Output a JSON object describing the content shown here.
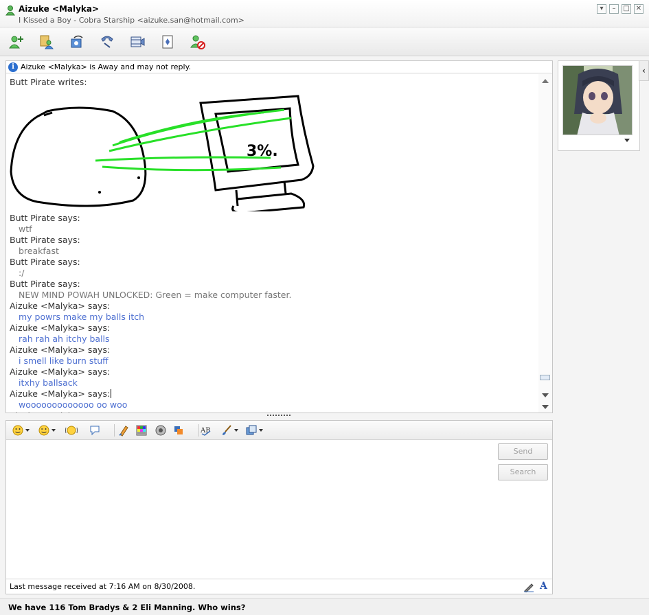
{
  "window": {
    "contact_name": "Aizuke <Malyka>",
    "personal_message": "I Kissed a Boy - Cobra Starship <aizuke.san@hotmail.com>",
    "controls": [
      "minimize-to-tray",
      "minimize",
      "maximize",
      "close"
    ]
  },
  "toolbar": {
    "buttons": [
      "invite-contact-icon",
      "share-files-icon",
      "video-call-icon",
      "call-icon",
      "video-icon",
      "games-icon",
      "block-icon"
    ]
  },
  "conversation": {
    "info_bar": "Aizuke <Malyka> is Away and may not reply.",
    "ink_header": "Butt Pirate writes:",
    "ink_label": "3%.",
    "messages": [
      {
        "speaker": "Butt Pirate says:",
        "text": "wtf",
        "style": "gray"
      },
      {
        "speaker": "Butt Pirate says:",
        "text": "breakfast",
        "style": "gray"
      },
      {
        "speaker": "Butt Pirate says:",
        "text": ":/",
        "style": "gray"
      },
      {
        "speaker": "Butt Pirate says:",
        "text": "NEW MIND POWAH UNLOCKED: Green = make computer faster.",
        "style": "gray"
      },
      {
        "speaker": "Aizuke <Malyka> says:",
        "text": "my powrs make my balls itch",
        "style": "blue"
      },
      {
        "speaker": "Aizuke <Malyka> says:",
        "text": "rah rah ah itchy balls",
        "style": "blue"
      },
      {
        "speaker": "Aizuke <Malyka> says:",
        "text": "i smell like burn stuff",
        "style": "blue"
      },
      {
        "speaker": "Aizuke <Malyka> says:",
        "text": "itxhy ballsack",
        "style": "blue"
      },
      {
        "speaker": "Aizuke <Malyka> says:",
        "text": "wooooooooooooo oo woo",
        "style": "blue"
      },
      {
        "speaker": "Aizuke <Malyka> says:",
        "text": "",
        "style": "blue"
      }
    ]
  },
  "compose": {
    "send_label": "Send",
    "search_label": "Search",
    "tools": [
      "emoticon-icon",
      "wink-icon",
      "nudge-icon",
      "voice-clip-icon",
      "handwriting-icon",
      "background-icon",
      "sound-icon",
      "games-icon",
      "spellcheck-icon",
      "font-icon",
      "paste-icon"
    ],
    "status": "Last message received at 7:16 AM on 8/30/2008."
  },
  "footer": {
    "ad_text": "We have 116 Tom Bradys & 2 Eli Manning. Who wins?"
  },
  "colors": {
    "ink_green": "#28e028",
    "message_blue": "#4d6fd1",
    "message_gray": "#777777"
  }
}
